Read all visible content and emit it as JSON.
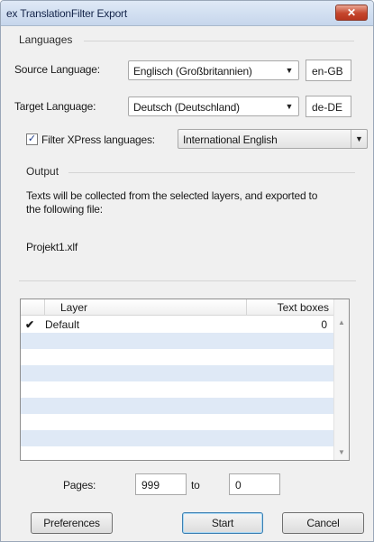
{
  "window": {
    "title": "ex TranslationFilter Export",
    "close_label": "✕"
  },
  "languages": {
    "section_label": "Languages",
    "source_label": "Source Language:",
    "source_value": "Englisch (Großbritannien)",
    "source_code": "en-GB",
    "target_label": "Target Language:",
    "target_value": "Deutsch (Deutschland)",
    "target_code": "de-DE",
    "filter_checked_glyph": "✓",
    "filter_label": "Filter XPress languages:",
    "filter_value": "International English"
  },
  "output": {
    "section_label": "Output",
    "description_line1": "Texts will be collected from the selected layers, and exported to",
    "description_line2": "the following file:",
    "filename": "Projekt1.xlf"
  },
  "layers_table": {
    "columns": [
      "Layer",
      "Text boxes"
    ],
    "rows": [
      {
        "check": "✔",
        "name": "Default",
        "text_boxes": "0"
      }
    ]
  },
  "pages": {
    "label": "Pages:",
    "from": "999",
    "to_label": "to",
    "to": "0"
  },
  "buttons": {
    "preferences": "Preferences",
    "start": "Start",
    "cancel": "Cancel"
  },
  "icons": {
    "dropdown": "chevron-down-icon",
    "scroll_up": "scroll-up-arrow-icon",
    "scroll_down": "scroll-down-arrow-icon"
  },
  "colors": {
    "row_alt": "#dfe9f6",
    "titlebar": "#c6d6ec",
    "close": "#c5452c"
  }
}
